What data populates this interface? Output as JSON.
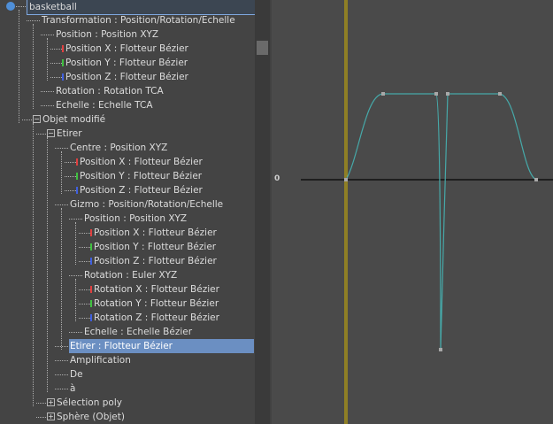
{
  "colors": {
    "panel_bg": "#444444",
    "graph_bg": "#4a4a4a",
    "selection": "#6b8fc2",
    "curve": "#46a9a9",
    "time_marker": "#d4b400",
    "x_tick": "#e04040",
    "y_tick": "#40c040",
    "z_tick": "#4060e0"
  },
  "tree": [
    {
      "label": "basketball",
      "icon": "root-dot-icon"
    },
    {
      "label": "Transformation : Position/Rotation/Echelle"
    },
    {
      "label": "Position : Position XYZ"
    },
    {
      "label": "Position X : Flotteur Bézier",
      "axis": "x"
    },
    {
      "label": "Position Y : Flotteur Bézier",
      "axis": "y"
    },
    {
      "label": "Position Z : Flotteur Bézier",
      "axis": "z"
    },
    {
      "label": "Rotation : Rotation TCA"
    },
    {
      "label": "Echelle : Echelle TCA"
    },
    {
      "label": "Objet modifié",
      "expander": "−"
    },
    {
      "label": "Etirer",
      "expander": "−"
    },
    {
      "label": "Centre : Position XYZ"
    },
    {
      "label": "Position X : Flotteur Bézier",
      "axis": "x"
    },
    {
      "label": "Position Y : Flotteur Bézier",
      "axis": "y"
    },
    {
      "label": "Position Z : Flotteur Bézier",
      "axis": "z"
    },
    {
      "label": "Gizmo : Position/Rotation/Echelle"
    },
    {
      "label": "Position : Position XYZ"
    },
    {
      "label": "Position X : Flotteur Bézier",
      "axis": "x"
    },
    {
      "label": "Position Y : Flotteur Bézier",
      "axis": "y"
    },
    {
      "label": "Position Z : Flotteur Bézier",
      "axis": "z"
    },
    {
      "label": "Rotation : Euler XYZ"
    },
    {
      "label": "Rotation X : Flotteur Bézier",
      "axis": "x"
    },
    {
      "label": "Rotation Y : Flotteur Bézier",
      "axis": "y"
    },
    {
      "label": "Rotation Z : Flotteur Bézier",
      "axis": "z"
    },
    {
      "label": "Echelle : Echelle Bézier"
    },
    {
      "label": "Etirer : Flotteur Bézier",
      "selected": true
    },
    {
      "label": "Amplification"
    },
    {
      "label": "De"
    },
    {
      "label": "à"
    },
    {
      "label": "Sélection poly",
      "expander": "+"
    },
    {
      "label": "Sphère (Objet)",
      "expander": "+"
    }
  ],
  "graph": {
    "zero_label": "0"
  }
}
